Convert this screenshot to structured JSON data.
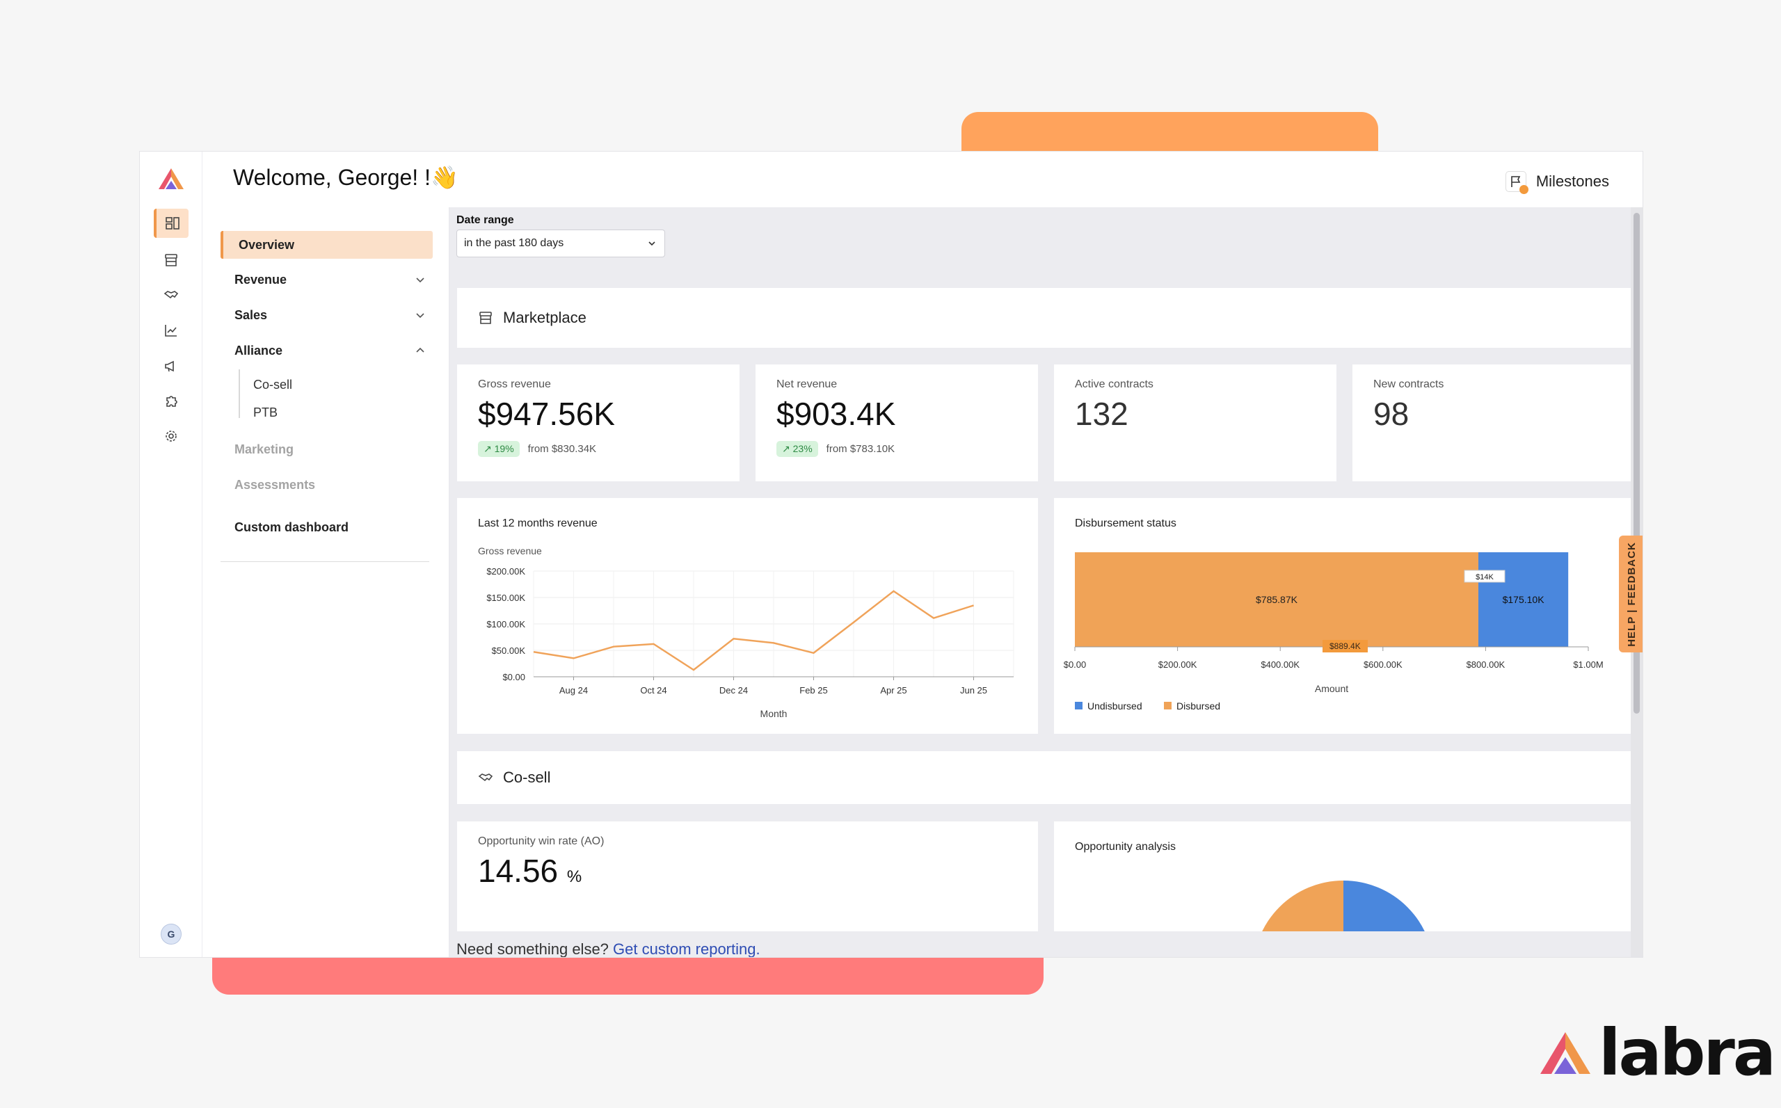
{
  "app": {
    "welcome": "Welcome, George! !👋",
    "milestones_label": "Milestones",
    "avatar_initial": "G"
  },
  "rail": {
    "icons": [
      "dashboard-icon",
      "storefront-icon",
      "handshake-icon",
      "chart-icon",
      "megaphone-icon",
      "puzzle-icon",
      "gear-icon"
    ],
    "active_index": 0
  },
  "subnav": {
    "overview": "Overview",
    "revenue": "Revenue",
    "sales": "Sales",
    "alliance": "Alliance",
    "alliance_children": [
      "Co-sell",
      "PTB"
    ],
    "marketing": "Marketing",
    "assessments": "Assessments",
    "custom_dashboard": "Custom dashboard"
  },
  "filters": {
    "date_range_label": "Date range",
    "date_range_value": "in the past 180 days"
  },
  "marketplace": {
    "title": "Marketplace",
    "kpis": [
      {
        "label": "Gross revenue",
        "value": "$947.56K",
        "change": "19%",
        "from": "from $830.34K"
      },
      {
        "label": "Net revenue",
        "value": "$903.4K",
        "change": "23%",
        "from": "from $783.10K"
      },
      {
        "label": "Active contracts",
        "value": "132"
      },
      {
        "label": "New contracts",
        "value": "98"
      }
    ]
  },
  "charts": {
    "revenue_title": "Last 12 months revenue",
    "revenue_sub": "Gross revenue",
    "disbursement_title": "Disbursement status",
    "total_tag": "$889.4K"
  },
  "chart_data": [
    {
      "type": "line",
      "title": "Last 12 months revenue",
      "subtitle": "Gross revenue",
      "xlabel": "Month",
      "ylabel": "",
      "x": [
        "Jul 24",
        "Aug 24",
        "Sep 24",
        "Oct 24",
        "Nov 24",
        "Dec 24",
        "Jan 25",
        "Feb 25",
        "Mar 25",
        "Apr 25",
        "May 25",
        "Jun 25",
        "Jul 25"
      ],
      "x_tick_labels": [
        "Aug 24",
        "Oct 24",
        "Dec 24",
        "Feb 25",
        "Apr 25",
        "Jun 25"
      ],
      "series": [
        {
          "name": "Gross revenue",
          "values": [
            47000,
            35000,
            57000,
            62000,
            13000,
            72000,
            64000,
            45000,
            103000,
            162000,
            111000,
            135000
          ]
        }
      ],
      "ylim": [
        0,
        200000
      ],
      "y_ticks": [
        "$0.00",
        "$50.00K",
        "$100.00K",
        "$150.00K",
        "$200.00K"
      ],
      "color": "#f0a35a"
    },
    {
      "type": "bar",
      "orientation": "horizontal-stacked",
      "title": "Disbursement status",
      "xlabel": "Amount",
      "series": [
        {
          "name": "Disbursed",
          "value": 785870,
          "label": "$785.87K",
          "color": "#f0a357"
        },
        {
          "name": "Undisbursed",
          "value": 175100,
          "label": "$175.10K",
          "color": "#4a87dd"
        }
      ],
      "callout": "$14K",
      "total_label": "$889.4K",
      "xlim": [
        0,
        1000000
      ],
      "x_ticks": [
        "$0.00",
        "$200.00K",
        "$400.00K",
        "$600.00K",
        "$800.00K",
        "$1.00M"
      ],
      "legend": [
        "Undisbursed",
        "Disbursed"
      ],
      "legend_position": "bottom-left"
    }
  ],
  "cosell": {
    "title": "Co-sell",
    "win_rate_label": "Opportunity win rate (AO)",
    "win_rate_value": "14.56",
    "win_rate_unit": "%",
    "opp_title": "Opportunity analysis"
  },
  "feedback_tab": "HELP | FEEDBACK",
  "footer": {
    "text": "Need something else?",
    "link": "Get custom reporting."
  },
  "brand": {
    "name": "labra"
  },
  "colors": {
    "accent": "#f0974a",
    "blue": "#4a87dd",
    "pink": "#ff7b7b"
  }
}
